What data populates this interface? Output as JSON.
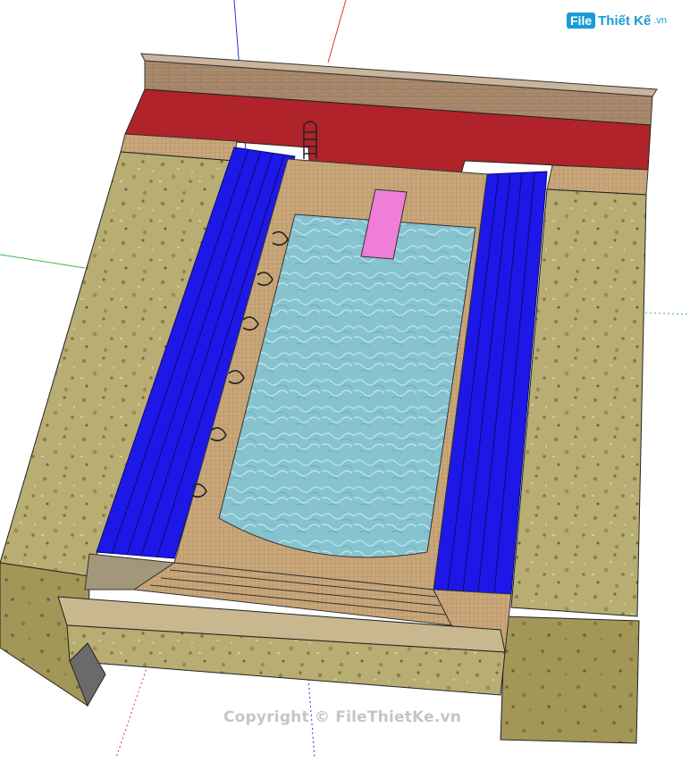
{
  "viewport": {
    "background": "#ffffff",
    "axes": {
      "blue": "#2a36d8",
      "red": "#d8383c",
      "green": "#3db84a"
    }
  },
  "logo": {
    "badge": "File",
    "word": "Thiết Kế",
    "tld": ".vn"
  },
  "watermark": "Copyright © FileThietKe.vn",
  "model": {
    "materials": {
      "brick_wall": "#a98a6c",
      "red_wall": "#b0232a",
      "deck_stone": "#b8ad72",
      "tile": "#c9a77a",
      "water": "#86c3cf",
      "blue_steps": "#1d18e8",
      "diving_board": "#ee7ed8",
      "side_face": "#a09456"
    },
    "components": [
      "back-brick-wall",
      "red-back-wall",
      "left-deck",
      "right-deck",
      "left-blue-steps",
      "right-blue-steps",
      "pool-water",
      "diving-board",
      "pool-ladder",
      "pool-handrails",
      "front-steps",
      "front-ledge"
    ]
  }
}
